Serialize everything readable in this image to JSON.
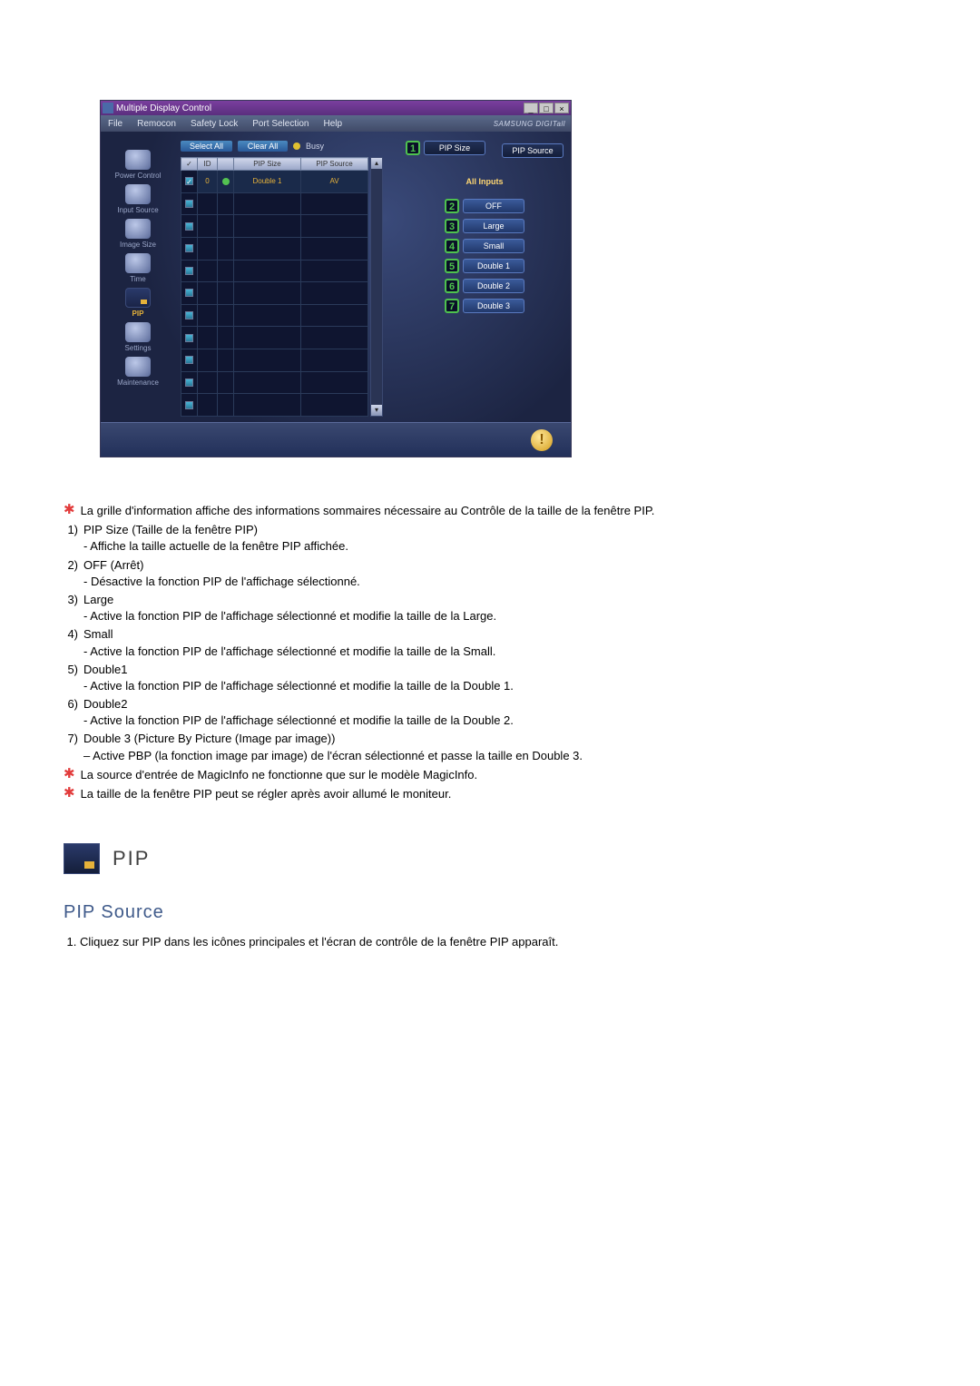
{
  "window": {
    "title": "Multiple Display Control",
    "titlebar_buttons": {
      "min": "_",
      "max": "□",
      "close": "×"
    },
    "menubar": [
      "File",
      "Remocon",
      "Safety Lock",
      "Port Selection",
      "Help"
    ],
    "brand": "SAMSUNG DIGITall"
  },
  "sidebar": {
    "items": [
      {
        "label": "Power Control"
      },
      {
        "label": "Input Source"
      },
      {
        "label": "Image Size"
      },
      {
        "label": "Time"
      },
      {
        "label": "PIP"
      },
      {
        "label": "Settings"
      },
      {
        "label": "Maintenance"
      }
    ]
  },
  "toolbar": {
    "select_all": "Select All",
    "clear_all": "Clear All",
    "busy": "Busy"
  },
  "grid": {
    "headers": {
      "chk": "✓",
      "id": "ID",
      "status": "",
      "pip_size": "PIP Size",
      "pip_source": "PIP Source"
    },
    "rows": [
      {
        "checked": true,
        "id": "0",
        "status": "green",
        "pip_size": "Double 1",
        "pip_source": "AV"
      },
      {
        "checked": false
      },
      {
        "checked": false
      },
      {
        "checked": false
      },
      {
        "checked": false
      },
      {
        "checked": false
      },
      {
        "checked": false
      },
      {
        "checked": false
      },
      {
        "checked": false
      },
      {
        "checked": false
      },
      {
        "checked": false
      }
    ]
  },
  "right_panel": {
    "pip_size_label": "PIP Size",
    "pip_source_label": "PIP Source",
    "all_inputs": "All Inputs",
    "options": [
      {
        "n": "2",
        "label": "OFF"
      },
      {
        "n": "3",
        "label": "Large"
      },
      {
        "n": "4",
        "label": "Small"
      },
      {
        "n": "5",
        "label": "Double 1"
      },
      {
        "n": "6",
        "label": "Double 2"
      },
      {
        "n": "7",
        "label": "Double 3"
      }
    ],
    "callout1": "1"
  },
  "statusbar": {
    "warn": "!"
  },
  "doc": {
    "star1": "La grille d'information affiche des informations sommaires nécessaire au Contrôle de la taille de la fenêtre PIP.",
    "list": [
      {
        "n": "1)",
        "t": "PIP Size (Taille de la fenêtre PIP)",
        "sub": "- Affiche la taille actuelle de la fenêtre PIP affichée."
      },
      {
        "n": "2)",
        "t": "OFF (Arrêt)",
        "sub": "- Désactive la fonction PIP de l'affichage sélectionné."
      },
      {
        "n": "3)",
        "t": "Large",
        "sub": "- Active la fonction PIP de l'affichage sélectionné et modifie la taille de la Large."
      },
      {
        "n": "4)",
        "t": "Small",
        "sub": "- Active la fonction PIP de l'affichage sélectionné et modifie la taille de la Small."
      },
      {
        "n": "5)",
        "t": "Double1",
        "sub": "- Active la fonction PIP de l'affichage sélectionné et modifie la taille de la Double 1."
      },
      {
        "n": "6)",
        "t": "Double2",
        "sub": "- Active la fonction PIP de l'affichage sélectionné et modifie la taille de la Double 2."
      },
      {
        "n": "7)",
        "t": "Double 3 (Picture By Picture (Image par image))",
        "sub": "– Active PBP (la fonction image par image) de l'écran sélectionné et passe la taille en Double 3."
      }
    ],
    "star2": "La source d'entrée de MagicInfo ne fonctionne que sur le modèle MagicInfo.",
    "star3": "La taille de la fenêtre PIP peut se régler après avoir allumé le moniteur.",
    "section": "PIP",
    "subsection": "PIP Source",
    "steps": [
      "Cliquez sur PIP dans les icônes principales et l'écran de contrôle de la fenêtre PIP apparaît."
    ]
  }
}
